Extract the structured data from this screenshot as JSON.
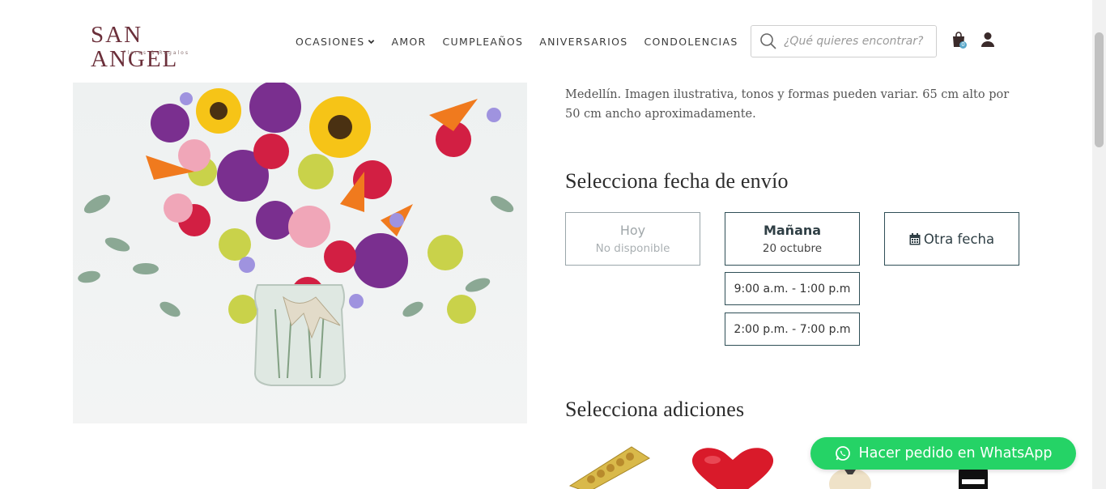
{
  "brand": {
    "name": "SAN ANGEL",
    "tagline": "Flores & Regalos"
  },
  "nav": {
    "items": [
      {
        "label": "OCASIONES",
        "has_dropdown": true
      },
      {
        "label": "AMOR"
      },
      {
        "label": "CUMPLEAÑOS"
      },
      {
        "label": "ANIVERSARIOS"
      },
      {
        "label": "CONDOLENCIAS"
      }
    ]
  },
  "search": {
    "placeholder": "¿Qué quieres encontrar?"
  },
  "cart": {
    "count": "0",
    "icon": "shopping-bag-icon"
  },
  "user": {
    "icon": "user-icon"
  },
  "description": {
    "text": "Medellín. Imagen ilustrativa, tonos y formas pueden variar. 65 cm alto por 50 cm ancho aproximadamente."
  },
  "shipping": {
    "title": "Selecciona fecha de envío",
    "options": [
      {
        "label": "Hoy",
        "sublabel": "No disponible",
        "available": false
      },
      {
        "label": "Mañana",
        "sublabel": "20 octubre",
        "available": true
      },
      {
        "label": "Otra fecha",
        "icon": "calendar-icon",
        "available": true
      }
    ],
    "time_slots": [
      "9:00 a.m. - 1:00 p.m",
      "2:00 p.m. - 7:00 p.m"
    ]
  },
  "addons": {
    "title": "Selecciona adiciones",
    "items": [
      {
        "name": "chocolates",
        "icon": "chocolate-box-icon"
      },
      {
        "name": "heart-balloon",
        "icon": "heart-balloon-icon"
      },
      {
        "name": "teddy-bear",
        "icon": "teddy-bear-icon"
      },
      {
        "name": "wine",
        "icon": "wine-bottle-icon"
      }
    ]
  },
  "whatsapp": {
    "label": "Hacer pedido en WhatsApp",
    "color": "#25d366"
  },
  "colors": {
    "brand": "#6b2f3a",
    "accent_border": "#2f4f57"
  }
}
